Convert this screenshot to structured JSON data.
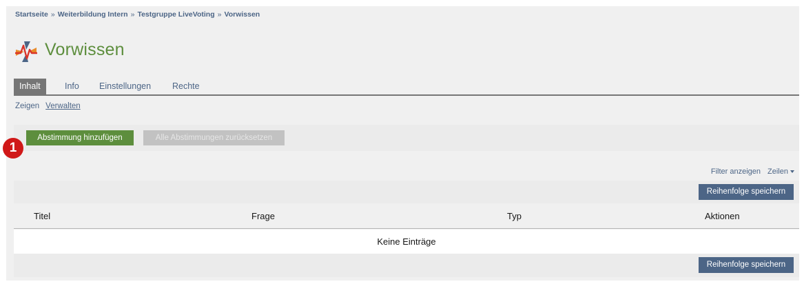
{
  "breadcrumb": {
    "items": [
      "Startseite",
      "Weiterbildung Intern",
      "Testgruppe LiveVoting",
      "Vorwissen"
    ],
    "separator": "»"
  },
  "header": {
    "title": "Vorwissen",
    "icon": "livevoting-logo-icon"
  },
  "tabs": [
    {
      "label": "Inhalt",
      "active": true
    },
    {
      "label": "Info",
      "active": false
    },
    {
      "label": "Einstellungen",
      "active": false
    },
    {
      "label": "Rechte",
      "active": false
    }
  ],
  "subtabs": [
    {
      "label": "Zeigen",
      "selected": false
    },
    {
      "label": "Verwalten",
      "selected": true
    }
  ],
  "toolbar": {
    "add_label": "Abstimmung hinzufügen",
    "reset_label": "Alle Abstimmungen zurücksetzen"
  },
  "annotation": {
    "marker": "1"
  },
  "table": {
    "filter_label": "Filter anzeigen",
    "rows_label": "Zeilen",
    "save_order_label": "Reihenfolge speichern",
    "columns": [
      "Titel",
      "Frage",
      "Typ",
      "Aktionen"
    ],
    "empty_text": "Keine Einträge"
  },
  "colors": {
    "accent_green": "#5d8e3d",
    "link_blue": "#4c6586",
    "tab_active": "#767676",
    "marker_red": "#d01818"
  }
}
